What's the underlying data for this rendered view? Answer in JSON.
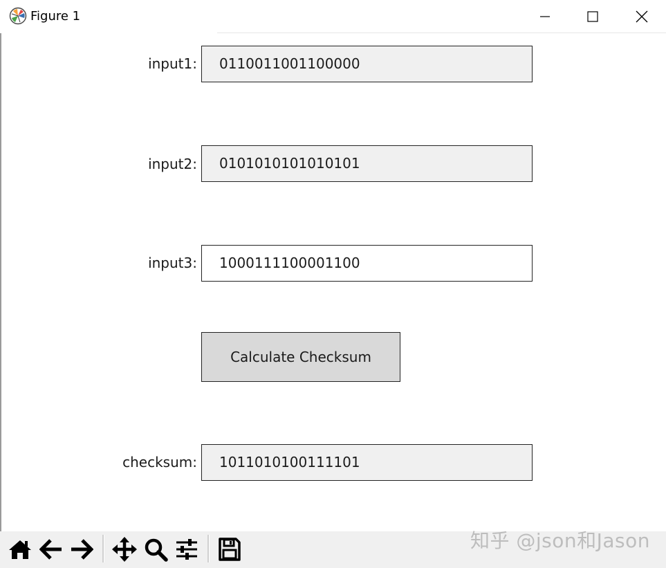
{
  "window": {
    "title": "Figure 1",
    "minimize_icon": "minimize-icon",
    "maximize_icon": "maximize-icon",
    "close_icon": "close-icon"
  },
  "form": {
    "input1": {
      "label": "input1:",
      "value": "0110011001100000"
    },
    "input2": {
      "label": "input2:",
      "value": "0101010101010101"
    },
    "input3": {
      "label": "input3:",
      "value": "1000111100001100"
    },
    "button": {
      "label": "Calculate Checksum"
    },
    "checksum": {
      "label": "checksum:",
      "value": "1011010100111101"
    }
  },
  "toolbar": {
    "icons": [
      "home-icon",
      "back-arrow-icon",
      "forward-arrow-icon",
      "pan-icon",
      "zoom-icon",
      "configure-subplots-icon",
      "save-icon"
    ]
  },
  "watermark": {
    "text": "知乎 @json和Jason"
  }
}
